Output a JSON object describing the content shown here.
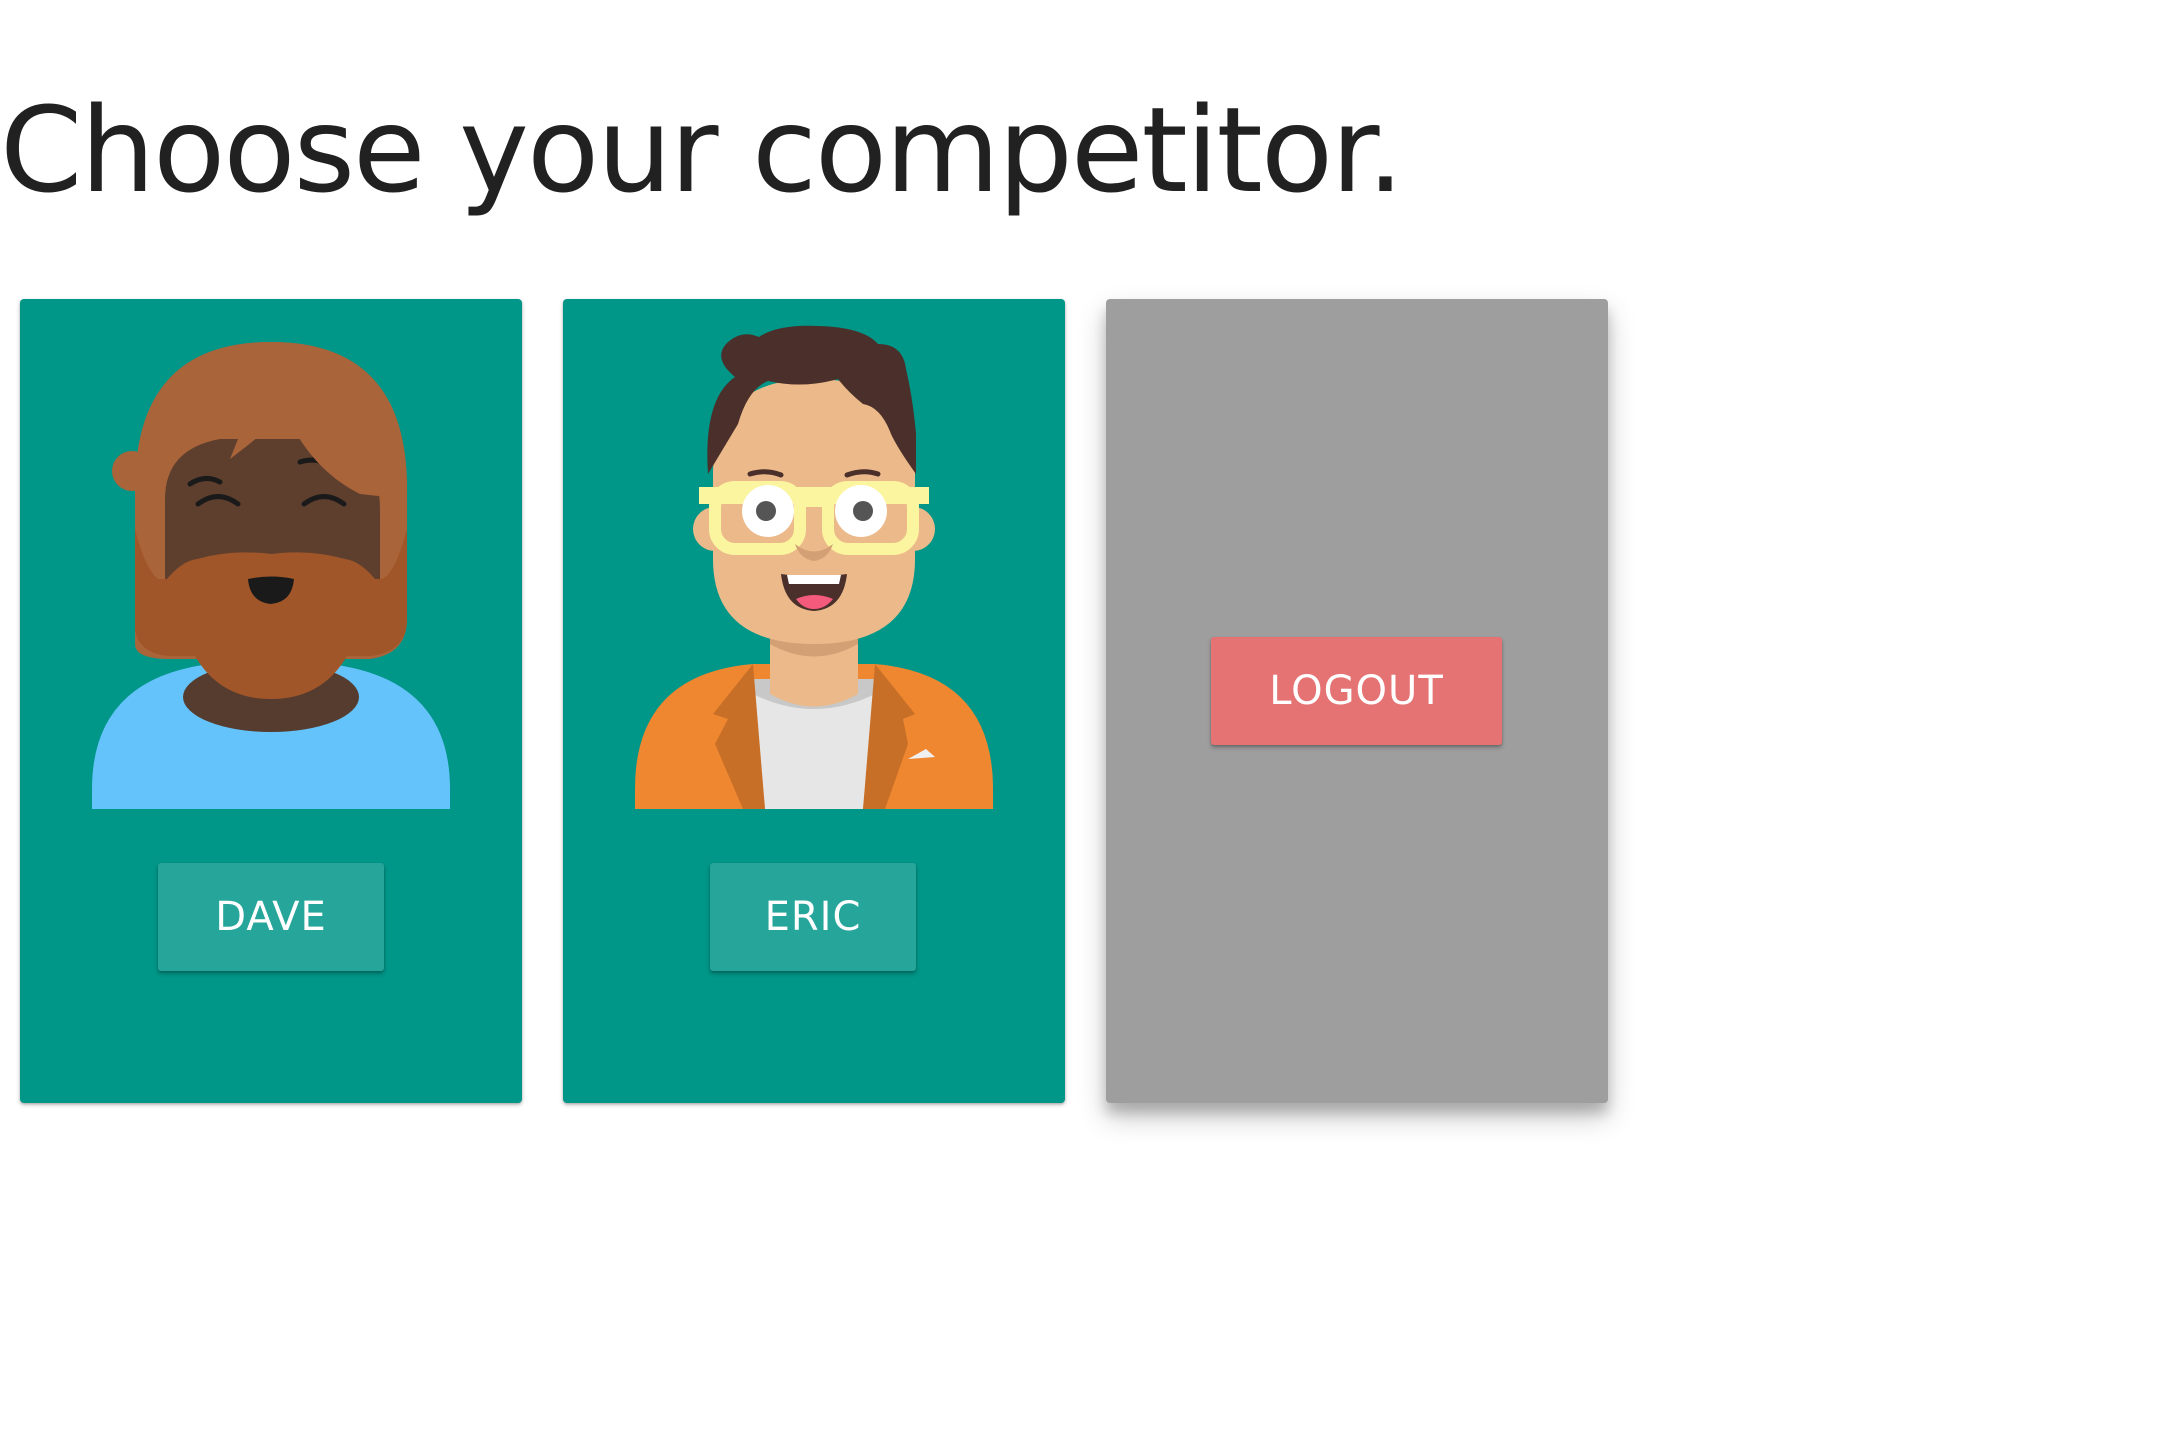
{
  "page": {
    "title": "Choose your competitor."
  },
  "competitors": [
    {
      "name": "DAVE",
      "avatar_icon": "dave-avatar-icon"
    },
    {
      "name": "ERIC",
      "avatar_icon": "eric-avatar-icon"
    }
  ],
  "logout": {
    "label": "LOGOUT"
  },
  "colors": {
    "card": "#009688",
    "button": "#26a69a",
    "logout_card": "#9e9e9e",
    "logout_button": "#e57373"
  }
}
